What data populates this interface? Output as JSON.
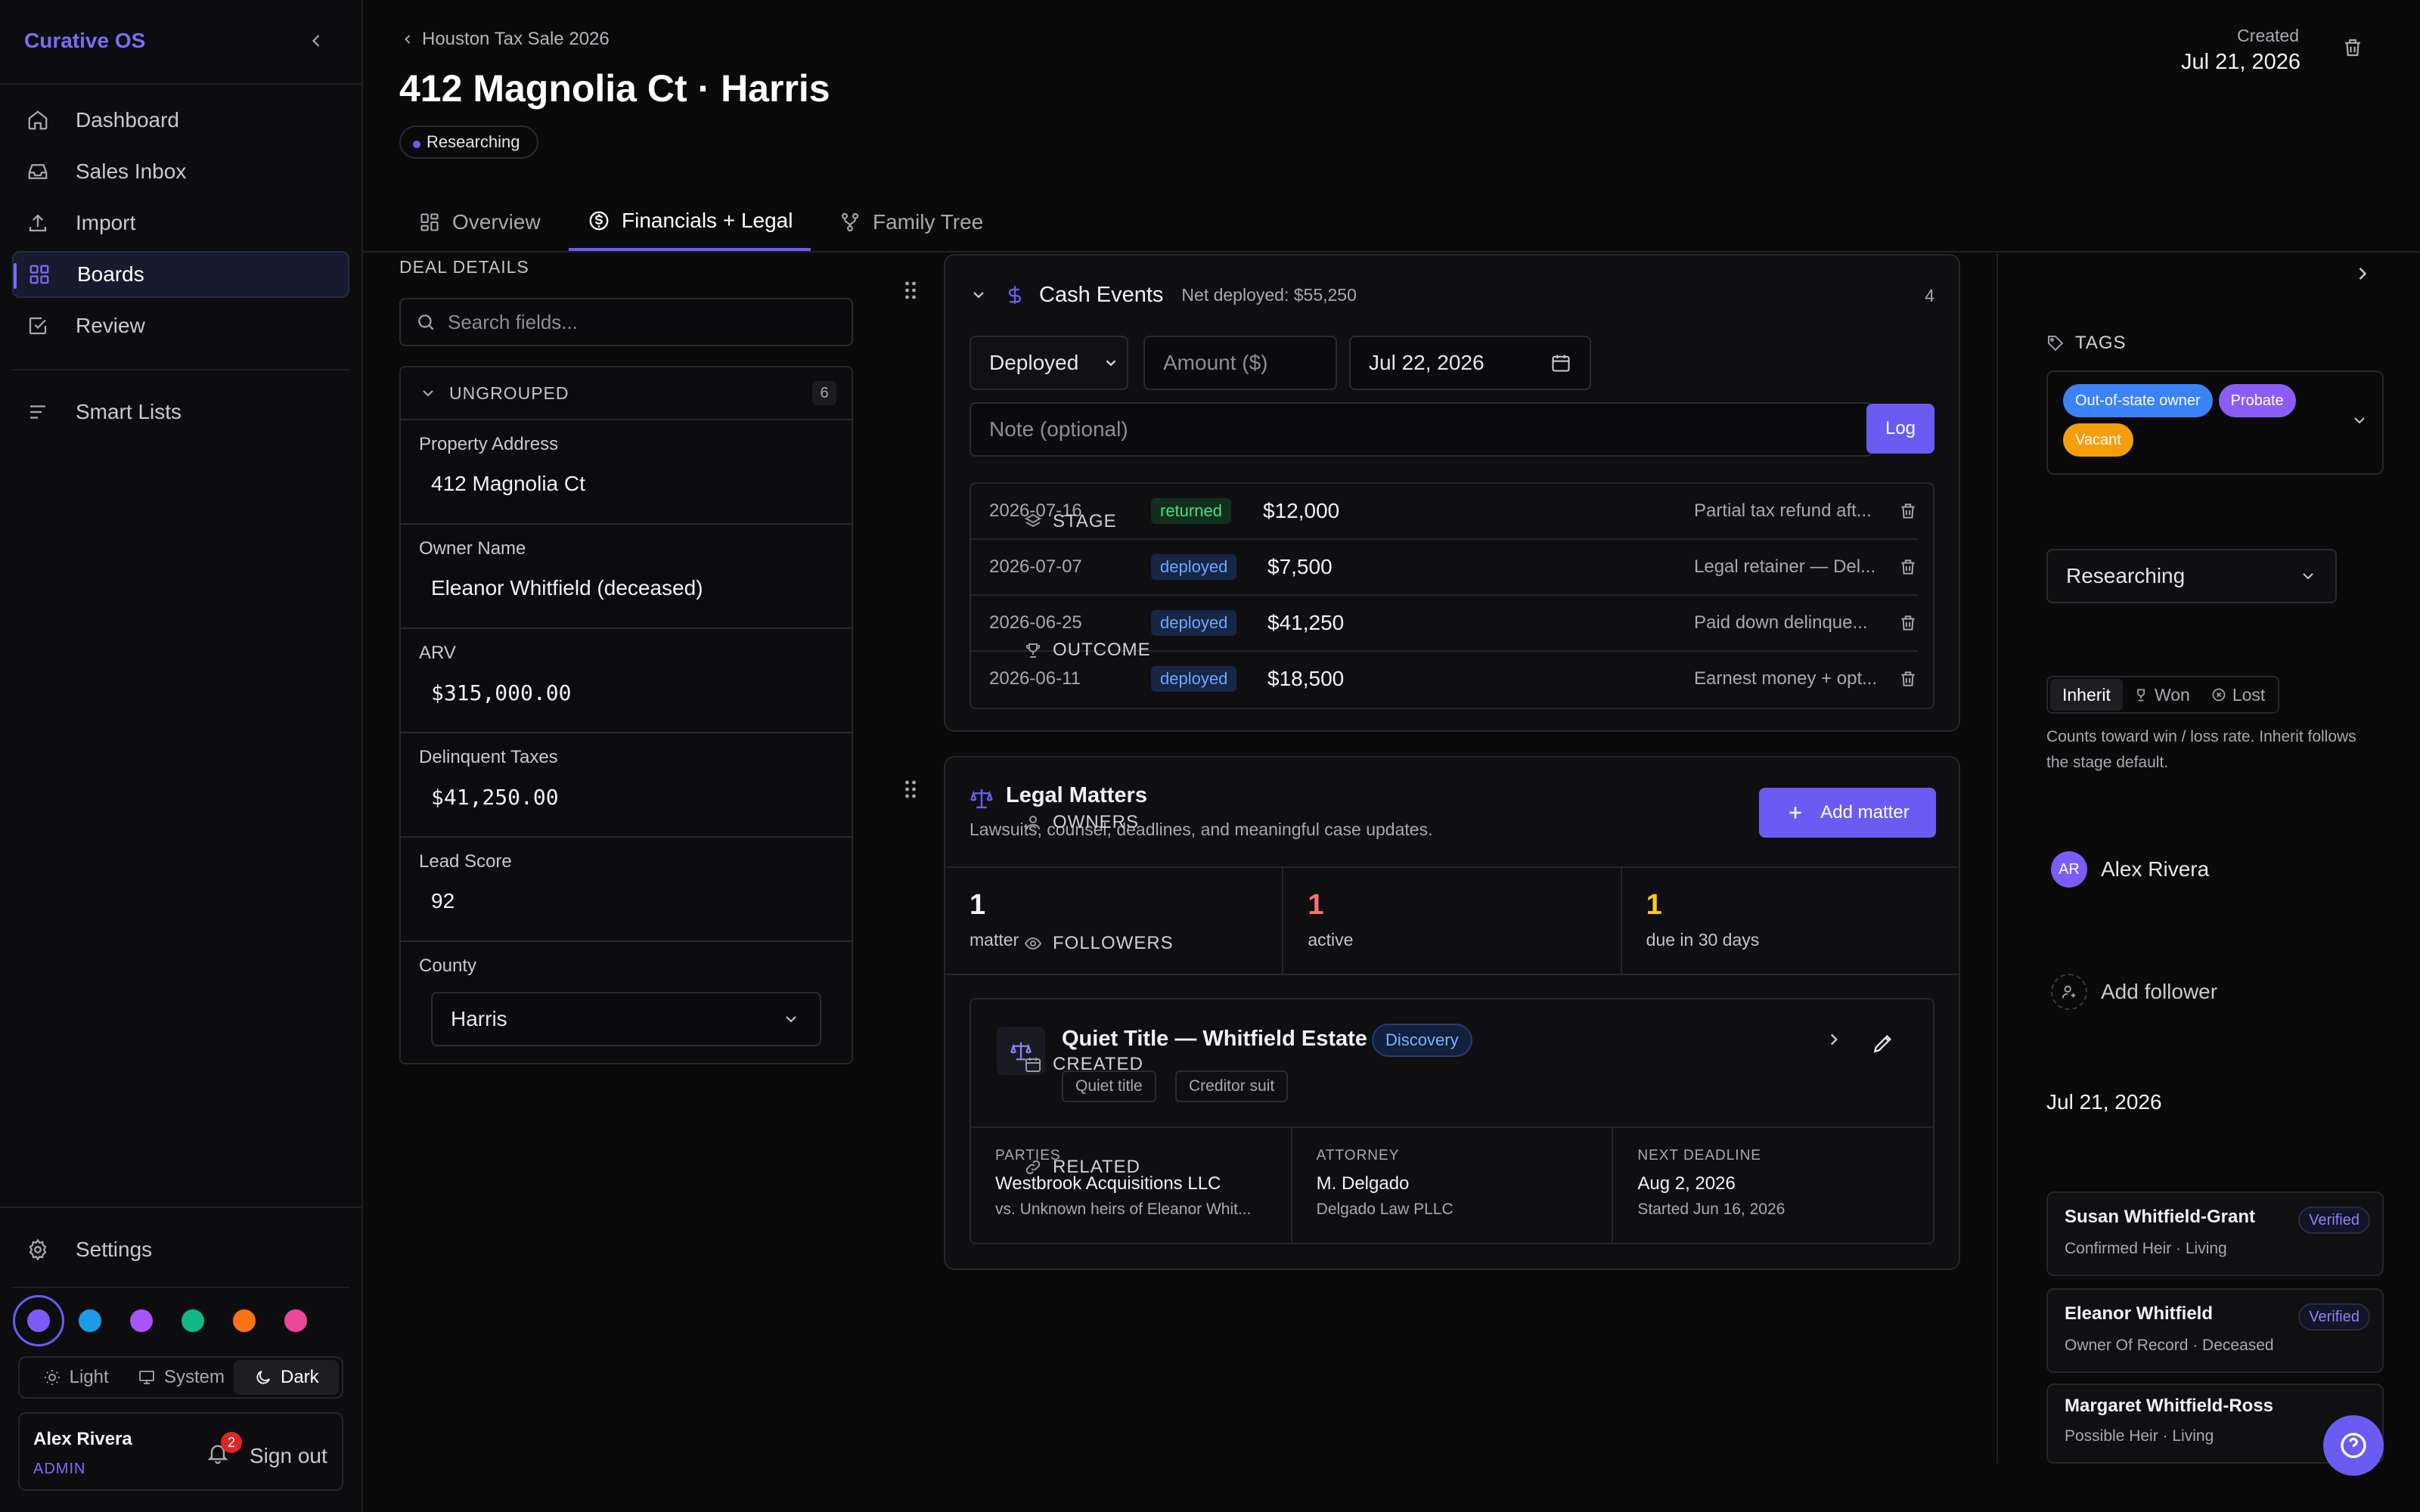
{
  "app": {
    "brand": "Curative OS"
  },
  "sidebar": {
    "items": [
      {
        "label": "Dashboard",
        "icon": "home-icon"
      },
      {
        "label": "Sales Inbox",
        "icon": "inbox-icon"
      },
      {
        "label": "Import",
        "icon": "upload-icon"
      },
      {
        "label": "Boards",
        "icon": "grid-icon",
        "active": true
      },
      {
        "label": "Review",
        "icon": "checkbox-icon"
      },
      {
        "label": "Smart Lists",
        "icon": "list-icon"
      }
    ],
    "settings": "Settings",
    "swatches": [
      "#7c5cf6",
      "#1e9be6",
      "#a855f7",
      "#10b981",
      "#f97316",
      "#ec4899"
    ],
    "theme": {
      "light": "Light",
      "system": "System",
      "dark": "Dark"
    },
    "user": {
      "name": "Alex Rivera",
      "role": "ADMIN",
      "notifications": "2",
      "signout": "Sign out"
    }
  },
  "header": {
    "breadcrumb": "Houston Tax Sale 2026",
    "title": "412 Magnolia Ct · Harris",
    "status": "Researching",
    "created_label": "Created",
    "created_value": "Jul 21, 2026"
  },
  "tabs": [
    {
      "label": "Overview"
    },
    {
      "label": "Financials + Legal"
    },
    {
      "label": "Family Tree"
    }
  ],
  "deal": {
    "heading": "DEAL DETAILS",
    "search_placeholder": "Search fields...",
    "group": "UNGROUPED",
    "group_count": "6",
    "fields": [
      {
        "label": "Property Address",
        "value": "412 Magnolia Ct"
      },
      {
        "label": "Owner Name",
        "value": "Eleanor Whitfield (deceased)"
      },
      {
        "label": "ARV",
        "value": "$315,000.00"
      },
      {
        "label": "Delinquent Taxes",
        "value": "$41,250.00"
      },
      {
        "label": "Lead Score",
        "value": "92"
      },
      {
        "label": "County",
        "value": "Harris"
      }
    ]
  },
  "cash": {
    "title": "Cash Events",
    "net": "Net deployed: $55,250",
    "count": "4",
    "type_value": "Deployed",
    "amount_placeholder": "Amount ($)",
    "date_value": "Jul 22, 2026",
    "note_placeholder": "Note (optional)",
    "log": "Log",
    "events": [
      {
        "date": "2026-07-16",
        "type": "returned",
        "amount": "$12,000",
        "note": "Partial tax refund aft..."
      },
      {
        "date": "2026-07-07",
        "type": "deployed",
        "amount": "$7,500",
        "note": "Legal retainer — Del..."
      },
      {
        "date": "2026-06-25",
        "type": "deployed",
        "amount": "$41,250",
        "note": "Paid down delinque..."
      },
      {
        "date": "2026-06-11",
        "type": "deployed",
        "amount": "$18,500",
        "note": "Earnest money + opt..."
      }
    ]
  },
  "legal": {
    "title": "Legal Matters",
    "subtitle": "Lawsuits, counsel, deadlines, and meaningful case updates.",
    "add": "Add matter",
    "stats": [
      {
        "value": "1",
        "label": "matter",
        "color": "#f2f2f4"
      },
      {
        "value": "1",
        "label": "active",
        "color": "#f87171"
      },
      {
        "value": "1",
        "label": "due in 30 days",
        "color": "#facc15"
      }
    ],
    "matter": {
      "title": "Quiet Title — Whitfield Estate",
      "stage": "Discovery",
      "tags": [
        "Quiet title",
        "Creditor suit"
      ],
      "parties_label": "PARTIES",
      "parties": "Westbrook Acquisitions LLC",
      "parties_sub": "vs. Unknown heirs of Eleanor Whit...",
      "attorney_label": "ATTORNEY",
      "attorney": "M. Delgado",
      "attorney_sub": "Delgado Law PLLC",
      "deadline_label": "NEXT DEADLINE",
      "deadline": "Aug 2, 2026",
      "deadline_sub": "Started Jun 16, 2026"
    }
  },
  "right": {
    "tags_label": "TAGS",
    "tags": [
      {
        "label": "Out-of-state owner",
        "color": "#3b82f6"
      },
      {
        "label": "Probate",
        "color": "#8b5cf6"
      },
      {
        "label": "Vacant",
        "color": "#f59e0b"
      }
    ],
    "stage_label": "STAGE",
    "stage_value": "Researching",
    "outcome_label": "OUTCOME",
    "outcome": {
      "inherit": "Inherit",
      "won": "Won",
      "lost": "Lost"
    },
    "outcome_help": "Counts toward win / loss rate. Inherit follows the stage default.",
    "owners_label": "OWNERS",
    "owner": {
      "initials": "AR",
      "name": "Alex Rivera"
    },
    "followers_label": "FOLLOWERS",
    "add_follower": "Add follower",
    "created_label": "CREATED",
    "created_value": "Jul 21, 2026",
    "related_label": "RELATED",
    "related": [
      {
        "name": "Susan Whitfield-Grant",
        "sub": "Confirmed Heir · Living",
        "badge": "Verified"
      },
      {
        "name": "Eleanor Whitfield",
        "sub": "Owner Of Record · Deceased",
        "badge": "Verified"
      },
      {
        "name": "Margaret Whitfield-Ross",
        "sub": "Possible Heir · Living",
        "badge": ""
      }
    ]
  }
}
